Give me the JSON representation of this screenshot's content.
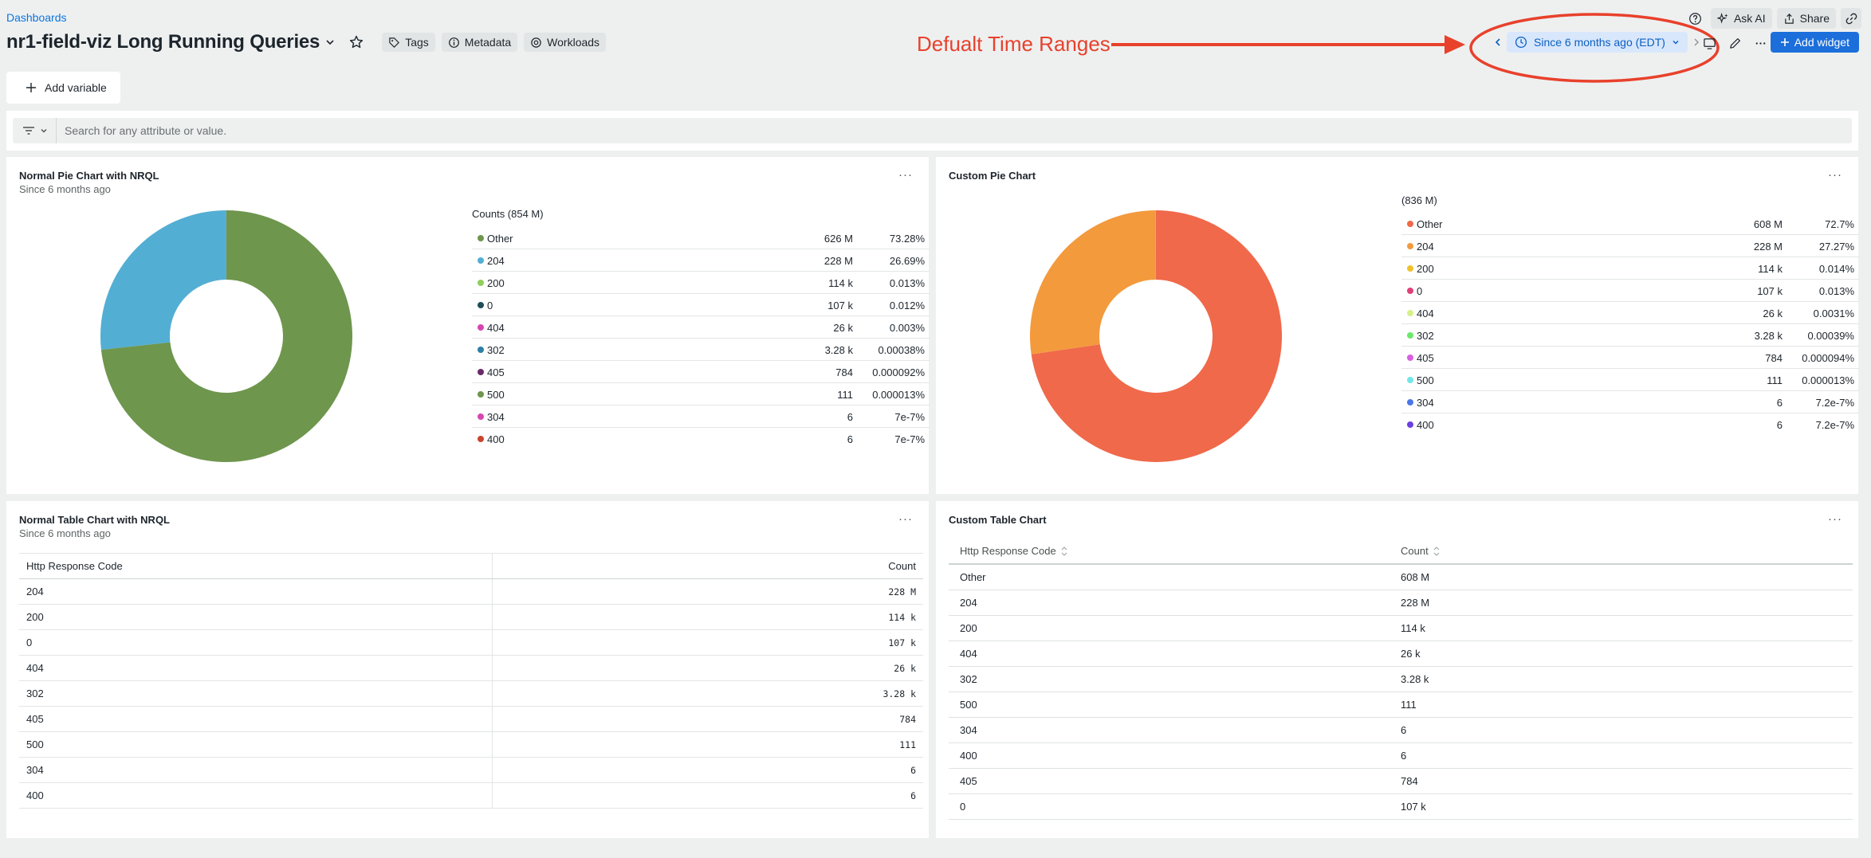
{
  "header": {
    "breadcrumb": "Dashboards",
    "title": "nr1-field-viz Long Running Queries",
    "tags_label": "Tags",
    "metadata_label": "Metadata",
    "workloads_label": "Workloads",
    "ask_ai_label": "Ask AI",
    "share_label": "Share",
    "time_range": "Since 6 months ago (EDT)",
    "add_widget_label": "Add widget"
  },
  "annotation": {
    "text": "Defualt Time Ranges",
    "color": "#e8412c"
  },
  "variables": {
    "add_variable_label": "Add variable"
  },
  "filter": {
    "placeholder": "Search for any attribute or value."
  },
  "widgets": {
    "normal_pie": {
      "title": "Normal Pie Chart with NRQL",
      "subtitle": "Since 6 months ago",
      "legend_heading": "Counts (854 M)",
      "rows": [
        {
          "label": "Other",
          "value": "626 M",
          "pct": "73.28%",
          "color": "#6e964d"
        },
        {
          "label": "204",
          "value": "228 M",
          "pct": "26.69%",
          "color": "#53aed3"
        },
        {
          "label": "200",
          "value": "114 k",
          "pct": "0.013%",
          "color": "#8fcf5c"
        },
        {
          "label": "0",
          "value": "107 k",
          "pct": "0.012%",
          "color": "#1f4d59"
        },
        {
          "label": "404",
          "value": "26 k",
          "pct": "0.003%",
          "color": "#d746b0"
        },
        {
          "label": "302",
          "value": "3.28 k",
          "pct": "0.00038%",
          "color": "#2d7fa5"
        },
        {
          "label": "405",
          "value": "784",
          "pct": "0.000092%",
          "color": "#6b2a6b"
        },
        {
          "label": "500",
          "value": "111",
          "pct": "0.000013%",
          "color": "#6e964d"
        },
        {
          "label": "304",
          "value": "6",
          "pct": "7e-7%",
          "color": "#d746b0"
        },
        {
          "label": "400",
          "value": "6",
          "pct": "7e-7%",
          "color": "#c9452e"
        }
      ]
    },
    "custom_pie": {
      "title": "Custom Pie Chart",
      "legend_heading": "(836 M)",
      "rows": [
        {
          "label": "Other",
          "value": "608 M",
          "pct": "72.7%",
          "color": "#f0694a"
        },
        {
          "label": "204",
          "value": "228 M",
          "pct": "27.27%",
          "color": "#f39a3d"
        },
        {
          "label": "200",
          "value": "114 k",
          "pct": "0.014%",
          "color": "#f2c12e"
        },
        {
          "label": "0",
          "value": "107 k",
          "pct": "0.013%",
          "color": "#e0407a"
        },
        {
          "label": "404",
          "value": "26 k",
          "pct": "0.0031%",
          "color": "#d6ef8a"
        },
        {
          "label": "302",
          "value": "3.28 k",
          "pct": "0.00039%",
          "color": "#6be86b"
        },
        {
          "label": "405",
          "value": "784",
          "pct": "0.000094%",
          "color": "#d85fe0"
        },
        {
          "label": "500",
          "value": "111",
          "pct": "0.000013%",
          "color": "#73e6e6"
        },
        {
          "label": "304",
          "value": "6",
          "pct": "7.2e-7%",
          "color": "#4a77e8"
        },
        {
          "label": "400",
          "value": "6",
          "pct": "7.2e-7%",
          "color": "#6a3fe0"
        }
      ]
    },
    "normal_table": {
      "title": "Normal Table Chart with NRQL",
      "subtitle": "Since 6 months ago",
      "headers": [
        "Http Response Code",
        "Count"
      ],
      "rows": [
        [
          "204",
          "228 M"
        ],
        [
          "200",
          "114 k"
        ],
        [
          "0",
          "107 k"
        ],
        [
          "404",
          "26 k"
        ],
        [
          "302",
          "3.28 k"
        ],
        [
          "405",
          "784"
        ],
        [
          "500",
          "111"
        ],
        [
          "304",
          "6"
        ],
        [
          "400",
          "6"
        ]
      ]
    },
    "custom_table": {
      "title": "Custom Table Chart",
      "headers": [
        "Http Response Code",
        "Count"
      ],
      "rows": [
        [
          "Other",
          "608 M"
        ],
        [
          "204",
          "228 M"
        ],
        [
          "200",
          "114 k"
        ],
        [
          "404",
          "26 k"
        ],
        [
          "302",
          "3.28 k"
        ],
        [
          "500",
          "111"
        ],
        [
          "304",
          "6"
        ],
        [
          "400",
          "6"
        ],
        [
          "405",
          "784"
        ],
        [
          "0",
          "107 k"
        ]
      ]
    }
  },
  "chart_data": [
    {
      "type": "pie",
      "title": "Normal Pie Chart with NRQL",
      "categories": [
        "Other",
        "204",
        "200",
        "0",
        "404",
        "302",
        "405",
        "500",
        "304",
        "400"
      ],
      "values": [
        73.28,
        26.69,
        0.013,
        0.012,
        0.003,
        0.00038,
        9.2e-05,
        1.3e-05,
        7e-07,
        7e-07
      ],
      "colors": [
        "#6e964d",
        "#53aed3",
        "#8fcf5c",
        "#1f4d59",
        "#d746b0",
        "#2d7fa5",
        "#6b2a6b",
        "#6e964d",
        "#d746b0",
        "#c9452e"
      ],
      "donut": true
    },
    {
      "type": "pie",
      "title": "Custom Pie Chart",
      "categories": [
        "Other",
        "204",
        "200",
        "0",
        "404",
        "302",
        "405",
        "500",
        "304",
        "400"
      ],
      "values": [
        72.7,
        27.27,
        0.014,
        0.013,
        0.0031,
        0.00039,
        9.4e-05,
        1.3e-05,
        7.2e-07,
        7.2e-07
      ],
      "colors": [
        "#f0694a",
        "#f39a3d",
        "#f2c12e",
        "#e0407a",
        "#d6ef8a",
        "#6be86b",
        "#d85fe0",
        "#73e6e6",
        "#4a77e8",
        "#6a3fe0"
      ],
      "donut": true
    }
  ]
}
